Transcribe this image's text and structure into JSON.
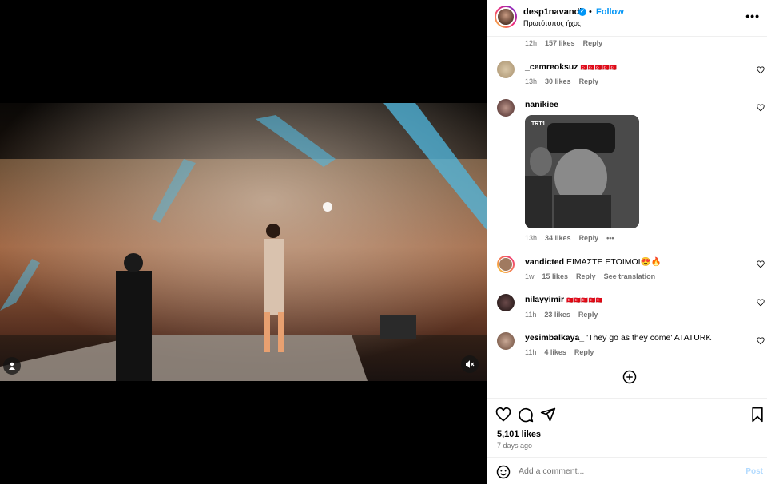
{
  "post": {
    "username": "desp1navandi",
    "verified": true,
    "separator": "•",
    "follow_label": "Follow",
    "audio": "Πρωτότυπος ήχος",
    "more_label": "•••"
  },
  "top_comment_meta": {
    "age": "12h",
    "likes": "157 likes",
    "reply": "Reply"
  },
  "comments": [
    {
      "username": "_cemreoksuz",
      "text": "",
      "flags": "🇹🇷🇹🇷🇹🇷🇹🇷🇹🇷",
      "age": "13h",
      "likes": "30 likes",
      "reply": "Reply"
    },
    {
      "username": "nanikiee",
      "text": "",
      "age": "13h",
      "likes": "34 likes",
      "reply": "Reply",
      "more": "•••",
      "gif_watermark": "TRT1"
    },
    {
      "username": "vandicted",
      "text": "ΕΙΜΑΣΤΕ ΕΤΟΙΜΟΙ😍🔥",
      "age": "1w",
      "likes": "15 likes",
      "reply": "Reply",
      "translate": "See translation"
    },
    {
      "username": "nilayyimir",
      "text": "",
      "flags": "🇹🇷🇹🇷🇹🇷🇹🇷🇹🇷",
      "age": "11h",
      "likes": "23 likes",
      "reply": "Reply"
    },
    {
      "username": "yesimbalkaya_",
      "text": "'They go as they come' ATATURK",
      "age": "11h",
      "likes": "4 likes",
      "reply": "Reply"
    }
  ],
  "footer": {
    "likes": "5,101 likes",
    "date": "7 days ago",
    "comment_placeholder": "Add a comment...",
    "post_label": "Post"
  },
  "colors": {
    "accent": "#0095f6",
    "muted": "#737373",
    "flag_red": "#e30a17"
  }
}
